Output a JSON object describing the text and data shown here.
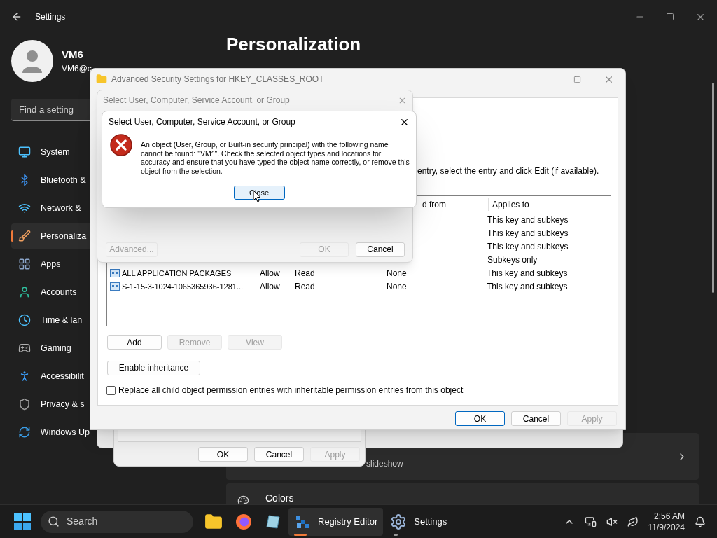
{
  "settings": {
    "title": "Settings",
    "user_name": "VM6",
    "user_email": "VM6@c",
    "search": {
      "placeholder": "Find a setting"
    },
    "heading": "Personalization",
    "nav": [
      {
        "label": "System",
        "selected": false
      },
      {
        "label": "Bluetooth &",
        "selected": false
      },
      {
        "label": "Network &",
        "selected": false
      },
      {
        "label": "Personaliza",
        "selected": true
      },
      {
        "label": "Apps",
        "selected": false
      },
      {
        "label": "Accounts",
        "selected": false
      },
      {
        "label": "Time & lan",
        "selected": false
      },
      {
        "label": "Gaming",
        "selected": false
      },
      {
        "label": "Accessibilit",
        "selected": false
      },
      {
        "label": "Privacy & s",
        "selected": false
      },
      {
        "label": "Windows Up",
        "selected": false
      }
    ],
    "cards": [
      {
        "kind": "subtitle",
        "text": "slideshow"
      },
      {
        "kind": "title",
        "text": "Colors"
      }
    ]
  },
  "back_dialog": {
    "buttons": [
      {
        "label": "OK",
        "disabled": false
      },
      {
        "label": "Cancel",
        "disabled": false
      },
      {
        "label": "Apply",
        "disabled": true
      }
    ]
  },
  "advanced_window": {
    "title": "Advanced Security Settings for HKEY_CLASSES_ROOT",
    "instruction": "entry, select the entry and click Edit (if available).",
    "columns": {
      "inherited": "d from",
      "applies": "Applies to"
    },
    "rows": [
      {
        "applies": "This key and subkeys"
      },
      {
        "applies": "This key and subkeys"
      },
      {
        "applies": "This key and subkeys"
      },
      {
        "applies": "Subkeys only"
      },
      {
        "principal": "ALL APPLICATION PACKAGES",
        "type": "Allow",
        "access": "Read",
        "inherited": "None",
        "applies": "This key and subkeys"
      },
      {
        "principal": "S-1-15-3-1024-1065365936-1281...",
        "type": "Allow",
        "access": "Read",
        "inherited": "None",
        "applies": "This key and subkeys"
      }
    ],
    "list_buttons": [
      {
        "label": "Add",
        "disabled": false
      },
      {
        "label": "Remove",
        "disabled": true
      },
      {
        "label": "View",
        "disabled": true
      }
    ],
    "inheritance_button": "Enable inheritance",
    "replace_checkbox": {
      "label": "Replace all child object permission entries with inheritable permission entries from this object",
      "checked": false
    },
    "buttons": [
      {
        "label": "OK",
        "disabled": false,
        "default": true
      },
      {
        "label": "Cancel",
        "disabled": false,
        "default": false
      },
      {
        "label": "Apply",
        "disabled": true,
        "default": false
      }
    ]
  },
  "select_dialog": {
    "title": "Select User, Computer, Service Account, or Group",
    "buttons": [
      {
        "label": "Advanced...",
        "disabled": true
      },
      {
        "label": "OK",
        "disabled": true
      },
      {
        "label": "Cancel",
        "disabled": false
      }
    ]
  },
  "error_dialog": {
    "title": "Select User, Computer, Service Account, or Group",
    "message": "An object (User, Group, or Built-in security principal) with the following name cannot be found: \"VM^\". Check the selected object types and locations for accuracy and ensure that you have typed the object name correctly, or remove this object from the selection.",
    "button": "Close"
  },
  "taskbar": {
    "search": {
      "placeholder": "Search"
    },
    "apps": [
      {
        "kind": "explorer",
        "selected": false,
        "running": false
      },
      {
        "kind": "firefox",
        "selected": false,
        "running": false
      },
      {
        "kind": "notepad",
        "selected": false,
        "running": false
      },
      {
        "kind": "registry",
        "label": "Registry Editor",
        "selected": true,
        "running": true
      },
      {
        "kind": "settings",
        "label": "Settings",
        "selected": false,
        "running": true
      }
    ],
    "time": "2:56 AM",
    "date": "11/9/2024"
  }
}
